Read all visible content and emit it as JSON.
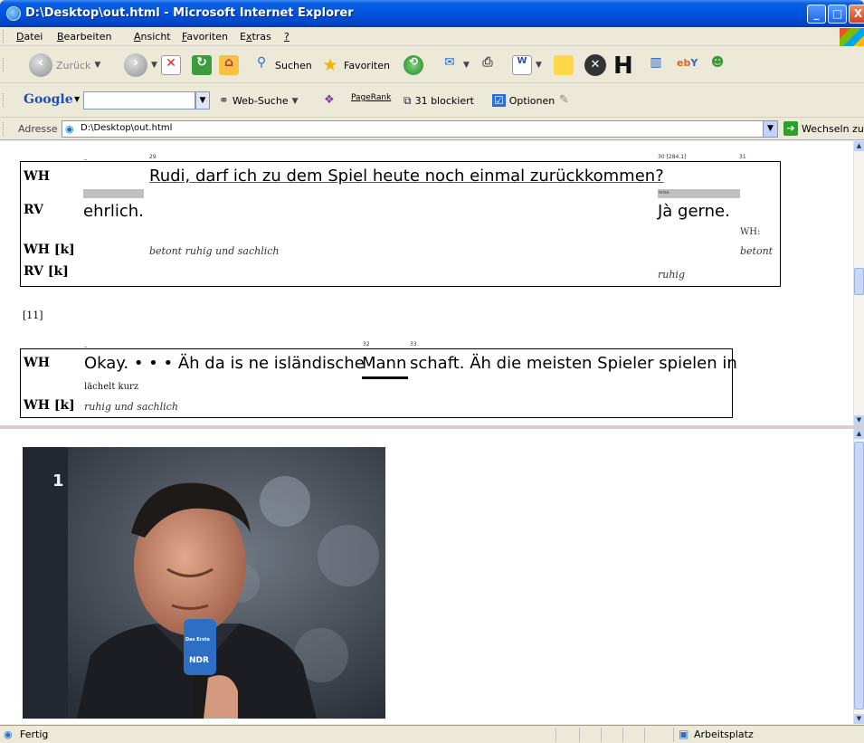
{
  "window": {
    "title": "D:\\Desktop\\out.html - Microsoft Internet Explorer",
    "min": "_",
    "max": "□",
    "close": "X"
  },
  "menu": [
    "Datei",
    "Bearbeiten",
    "Ansicht",
    "Favoriten",
    "Extras",
    "?"
  ],
  "menu_hotkeys": [
    "D",
    "B",
    "A",
    "F",
    "x",
    "?"
  ],
  "toolbar": {
    "back": "Zurück",
    "search": "Suchen",
    "favorites": "Favoriten"
  },
  "google": {
    "logo": "Google",
    "search_value": "",
    "web_search": "Web-Suche",
    "pagerank": "PageRank",
    "blocked": "31 blockiert",
    "options": "Optionen"
  },
  "address": {
    "label": "Adresse",
    "value": "D:\\Desktop\\out.html",
    "go": "Wechseln zu"
  },
  "score1": {
    "timeline": {
      "t_start": "_",
      "t29": "29",
      "t30": "30 [284.1]",
      "t31": "31"
    },
    "row_wh": {
      "label": "WH",
      "text": "Rudi, darf ich zu dem Spiel heute noch einmal zurückkommen?"
    },
    "row_small": {
      "label": "leise"
    },
    "row_rv": {
      "label": "RV",
      "text1": "ehrlich.",
      "text2": "Jà gerne."
    },
    "wh_extra": "WH:",
    "row_whk": {
      "label": "WH [k]",
      "text": "betont ruhig und sachlich",
      "text2": "betont"
    },
    "row_rvk": {
      "label": "RV [k]",
      "text": "ruhig"
    }
  },
  "section_marker": "[11]",
  "score2": {
    "timeline": {
      "t_start": "_",
      "t32": "32",
      "t33": "33"
    },
    "row_wh": {
      "label": "WH",
      "text_a": "Okay. • • • Äh da is ne isländische",
      "text_b": "Mann",
      "text_c": "schaft. Äh die meisten Spieler spielen in"
    },
    "row_sub": "lächelt kurz",
    "row_whk": {
      "label": "WH [k]",
      "text": "ruhig und sachlich"
    }
  },
  "video": {
    "channel_logo": "1",
    "mic_logo": "Das Erste",
    "mic_label": "NDR"
  },
  "status": {
    "text": "Fertig",
    "zone": "Arbeitsplatz"
  }
}
